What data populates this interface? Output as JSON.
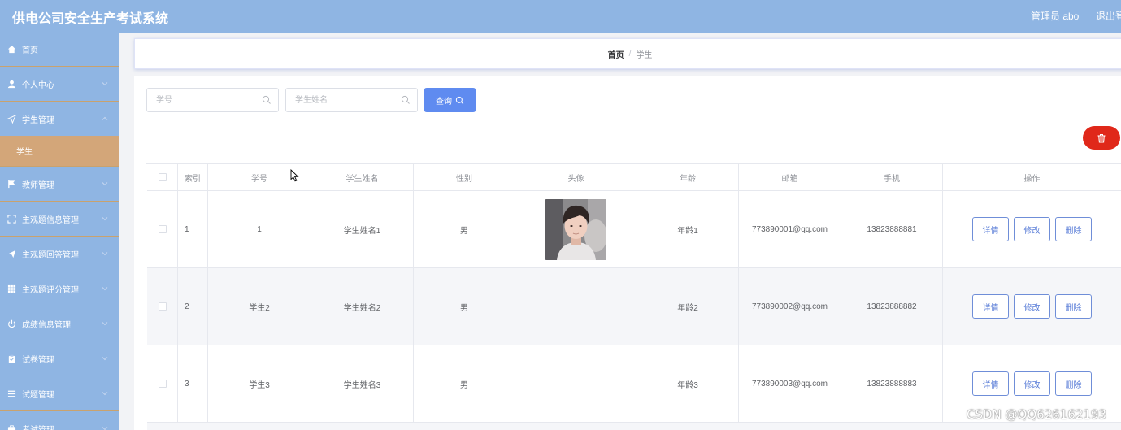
{
  "app": {
    "title": "供电公司安全生产考试系统"
  },
  "header": {
    "user_label": "管理员 abo",
    "logout_label": "退出登"
  },
  "sidebar": {
    "items": [
      {
        "label": "首页",
        "icon": "home-icon"
      },
      {
        "label": "个人中心",
        "icon": "user-icon"
      },
      {
        "label": "学生管理",
        "icon": "send-icon"
      },
      {
        "label": "学生",
        "icon": ""
      },
      {
        "label": "教师管理",
        "icon": "flag-icon"
      },
      {
        "label": "主观题信息管理",
        "icon": "frame-icon"
      },
      {
        "label": "主观题回答管理",
        "icon": "plane-icon"
      },
      {
        "label": "主观题评分管理",
        "icon": "grid-icon"
      },
      {
        "label": "成绩信息管理",
        "icon": "power-icon"
      },
      {
        "label": "试卷管理",
        "icon": "clipboard-icon"
      },
      {
        "label": "试题管理",
        "icon": "list-icon"
      },
      {
        "label": "考试管理",
        "icon": "briefcase-icon"
      }
    ]
  },
  "breadcrumb": {
    "home": "首页",
    "separator": "/",
    "current": "学生"
  },
  "search": {
    "student_no_placeholder": "学号",
    "student_name_placeholder": "学生姓名",
    "query_label": "查询"
  },
  "table": {
    "columns": [
      "索引",
      "学号",
      "学生姓名",
      "性别",
      "头像",
      "年龄",
      "邮箱",
      "手机",
      "操作"
    ],
    "rows": [
      {
        "index": "1",
        "student_no": "1",
        "name": "学生姓名1",
        "gender": "男",
        "has_avatar": true,
        "age": "年龄1",
        "email": "773890001@qq.com",
        "phone": "13823888881"
      },
      {
        "index": "2",
        "student_no": "学生2",
        "name": "学生姓名2",
        "gender": "男",
        "has_avatar": false,
        "age": "年龄2",
        "email": "773890002@qq.com",
        "phone": "13823888882"
      },
      {
        "index": "3",
        "student_no": "学生3",
        "name": "学生姓名3",
        "gender": "男",
        "has_avatar": false,
        "age": "年龄3",
        "email": "773890003@qq.com",
        "phone": "13823888883"
      }
    ],
    "actions": {
      "detail": "详情",
      "edit": "修改",
      "delete": "删除"
    }
  },
  "watermark": "CSDN @QQ626162193",
  "colors": {
    "sidebar": "#8fb5e3",
    "active_menu": "#d3a679",
    "primary": "#5f8bf0",
    "danger": "#e0281a"
  }
}
